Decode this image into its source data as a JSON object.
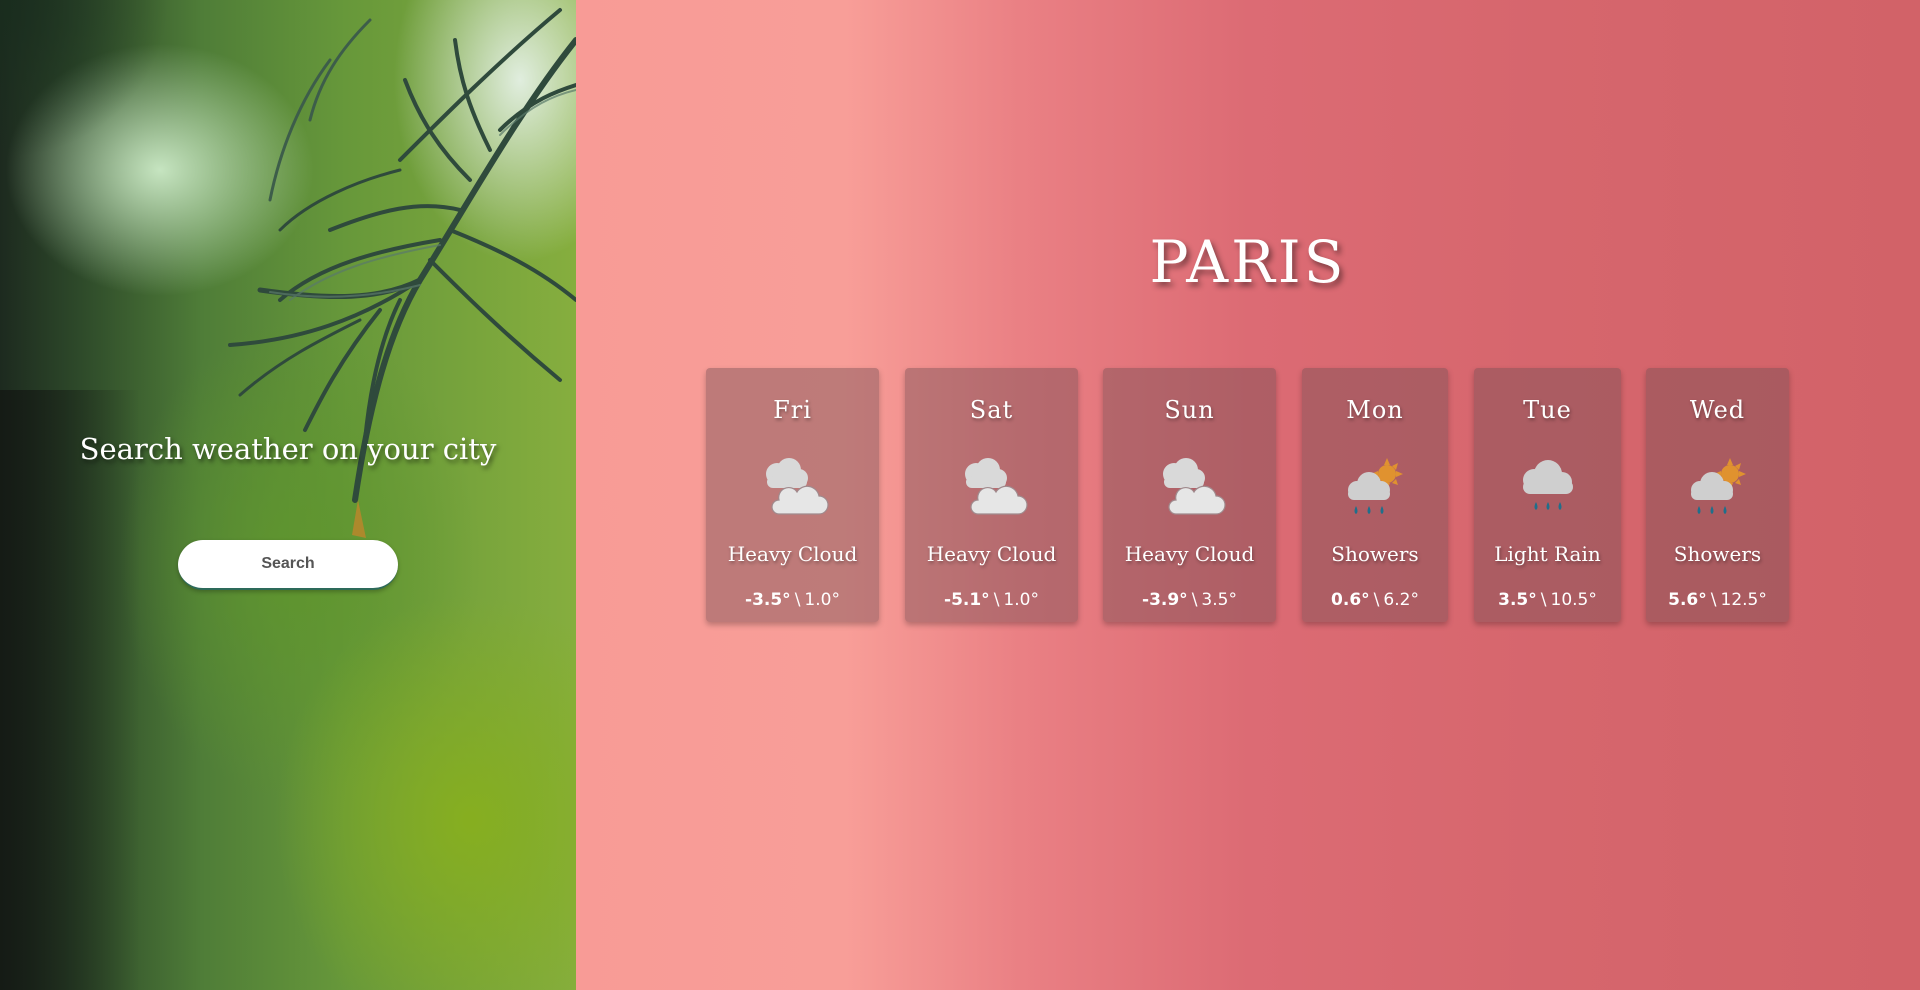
{
  "search_panel": {
    "heading": "Search weather on your city",
    "button_label": "Search"
  },
  "city": "PARIS",
  "forecast": [
    {
      "day": "Fri",
      "icon": "heavy-cloud-icon",
      "condition": "Heavy Cloud",
      "min": "-3.5°",
      "max": "1.0°"
    },
    {
      "day": "Sat",
      "icon": "heavy-cloud-icon",
      "condition": "Heavy Cloud",
      "min": "-5.1°",
      "max": "1.0°"
    },
    {
      "day": "Sun",
      "icon": "heavy-cloud-icon",
      "condition": "Heavy Cloud",
      "min": "-3.9°",
      "max": "3.5°"
    },
    {
      "day": "Mon",
      "icon": "showers-icon",
      "condition": "Showers",
      "min": "0.6°",
      "max": "6.2°"
    },
    {
      "day": "Tue",
      "icon": "light-rain-icon",
      "condition": "Light Rain",
      "min": "3.5°",
      "max": "10.5°"
    },
    {
      "day": "Wed",
      "icon": "showers-icon",
      "condition": "Showers",
      "min": "5.6°",
      "max": "12.5°"
    }
  ],
  "temp_separator": "\\",
  "colors": {
    "panel_gradient_start": "#f89b96",
    "panel_gradient_end": "#d26268",
    "card_background": "#785055",
    "sun": "#e0922f",
    "rain_drop": "#1f6f8b",
    "cloud": "#d9d9d9"
  }
}
